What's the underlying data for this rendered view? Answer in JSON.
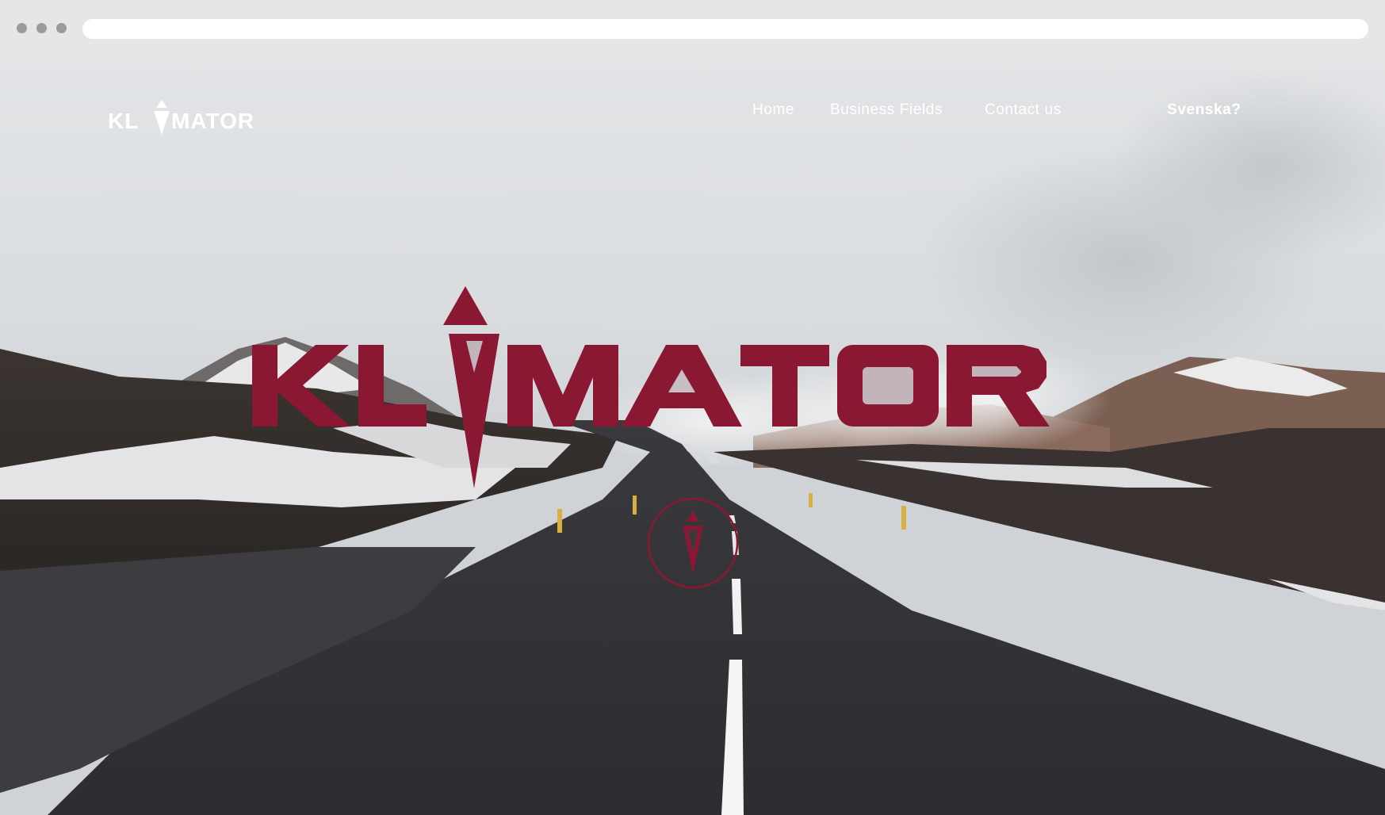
{
  "window": {
    "url": ""
  },
  "brand": {
    "name": "KLIMATOR",
    "accent_color": "#8b1832",
    "logo_icon": "klimator-diamond-icon"
  },
  "nav": {
    "items": [
      {
        "label": "Home"
      },
      {
        "label": "Business Fields"
      },
      {
        "label": "Contact us"
      }
    ],
    "language_label": "Svenska?"
  },
  "hero": {
    "scroll_icon": "scroll-down-icon"
  }
}
